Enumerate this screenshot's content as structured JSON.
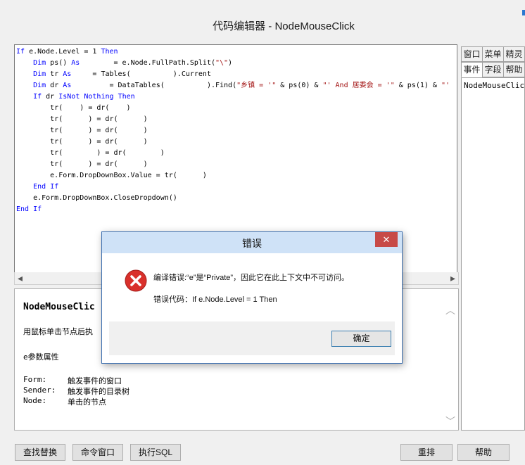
{
  "window": {
    "title": "代码编辑器 - NodeMouseClick"
  },
  "code": {
    "lines": [
      "If e.Node.Level = 1 Then",
      "    Dim ps() As        = e.Node.FullPath.Split(\"\\\")",
      "    Dim tr As     = Tables(          ).Current",
      "    Dim dr As         = DataTables(          ).Find(\"乡镇 = '\" & ps(0) & \"' And 居委会 = '\" & ps(1) & \"'",
      "    If dr IsNot Nothing Then",
      "        tr(    ) = dr(    )",
      "        tr(      ) = dr(      )",
      "        tr(      ) = dr(      )",
      "        tr(      ) = dr(      )",
      "        tr(        ) = dr(        )",
      "        tr(      ) = dr(      )",
      "        e.Form.DropDownBox.Value = tr(      )",
      "    End If",
      "    e.Form.DropDownBox.CloseDropdown()",
      "End If"
    ]
  },
  "description": {
    "heading": "NodeMouseClic",
    "summary": "用鼠标单击节点后执",
    "params_title": "e参数属性",
    "params": [
      {
        "name": "Form:",
        "desc": "触发事件的窗口"
      },
      {
        "name": "Sender:",
        "desc": "触发事件的目录树"
      },
      {
        "name": "Node:",
        "desc": "单击的节点"
      }
    ]
  },
  "side_tabs": {
    "row1": [
      "窗口",
      "菜单",
      "精灵"
    ],
    "row2": [
      "事件",
      "字段",
      "帮助"
    ],
    "active": "事件"
  },
  "event_list": [
    "NodeMouseClick"
  ],
  "bottom_buttons": {
    "find_replace": "查找替换",
    "command_window": "命令窗口",
    "execute_sql": "执行SQL",
    "rearrange": "重排",
    "help": "帮助"
  },
  "dialog": {
    "title": "错误",
    "message": "编译错误:“e”是“Private”，因此它在此上下文中不可访问。",
    "code_line": "错误代码：If e.Node.Level = 1 Then",
    "ok_label": "确定",
    "close_glyph": "✕"
  },
  "icons": {
    "error": "error-x-icon",
    "scroll_left": "◂",
    "scroll_right": "▸",
    "scroll_up": "︿",
    "scroll_down": "﹀"
  },
  "colors": {
    "keyword": "#0000ff",
    "string": "#a31515",
    "close_red": "#c74a47",
    "error_red": "#d9302b"
  }
}
